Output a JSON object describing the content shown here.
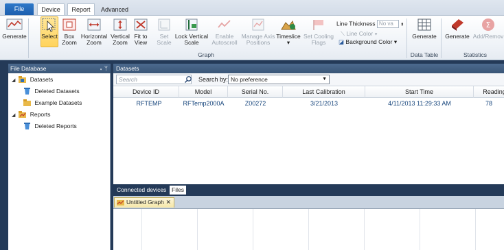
{
  "tabs": {
    "file": "File",
    "device": "Device",
    "report": "Report",
    "advanced": "Advanced"
  },
  "ribbon": {
    "generate": "Generate",
    "select": "Select",
    "box_zoom": [
      "Box",
      "Zoom"
    ],
    "horizontal_zoom": [
      "Horizontal",
      "Zoom"
    ],
    "vertical_zoom": [
      "Vertical",
      "Zoom"
    ],
    "fit_to_view": [
      "Fit to",
      "View"
    ],
    "set_scale": [
      "Set",
      "Scale"
    ],
    "lock_vertical_scale": [
      "Lock Vertical",
      "Scale"
    ],
    "enable_autoscroll": [
      "Enable",
      "Autoscroll"
    ],
    "manage_axis_positions": [
      "Manage Axis",
      "Positions"
    ],
    "timeslice": "Timeslice",
    "set_cooling_flags": [
      "Set Cooling",
      "Flags"
    ],
    "line_thickness_label": "Line Thickness",
    "line_thickness_value": "No va",
    "line_color": "Line Color",
    "background_color": "Background Color",
    "graph_group": "Graph",
    "data_table_generate": "Generate",
    "data_table_group": "Data Table",
    "statistics_generate": "Generate",
    "add_remove": "Add/Remov",
    "statistics_group": "Statistics"
  },
  "left_pane": {
    "title": "File Database",
    "pin": "▾ ᛘ",
    "tree": [
      {
        "label": "Datasets",
        "level": 0
      },
      {
        "label": "Deleted Datasets",
        "level": 1
      },
      {
        "label": "Example Datasets",
        "level": 1
      },
      {
        "label": "Reports",
        "level": 0
      },
      {
        "label": "Deleted Reports",
        "level": 1
      }
    ]
  },
  "right_pane": {
    "title": "Datasets",
    "search_placeholder": "Search",
    "search_by_label": "Search by:",
    "search_by_value": "No preference",
    "columns": [
      "Device ID",
      "Model",
      "Serial No.",
      "Last Calibration",
      "Start Time",
      "Reading"
    ],
    "rows": [
      [
        "RFTEMP",
        "RFTemp2000A",
        "Z00272",
        "3/21/2013",
        "4/11/2013 11:29:33 AM",
        "78"
      ]
    ]
  },
  "bottom_tabs": {
    "connected_devices": "Connected devices",
    "files": "Files"
  },
  "doc_tab": {
    "label": "Untitled Graph",
    "close": "✕"
  },
  "icons": [
    "generate-icon",
    "select-icon",
    "box-zoom-icon",
    "horizontal-zoom-icon",
    "vertical-zoom-icon",
    "fit-to-view-icon",
    "set-scale-icon",
    "lock-vertical-scale-icon",
    "enable-autoscroll-icon",
    "manage-axis-icon",
    "timeslice-icon",
    "cooling-flags-icon",
    "data-table-icon",
    "statistics-icon",
    "add-remove-icon",
    "folder-icon",
    "recycle-bin-icon",
    "search-icon"
  ],
  "colors": {
    "accent_blue": "#1d5fae",
    "pane_header": "#3a5677",
    "dark_frame": "#243a58",
    "selected_button": "#ffd35c"
  }
}
